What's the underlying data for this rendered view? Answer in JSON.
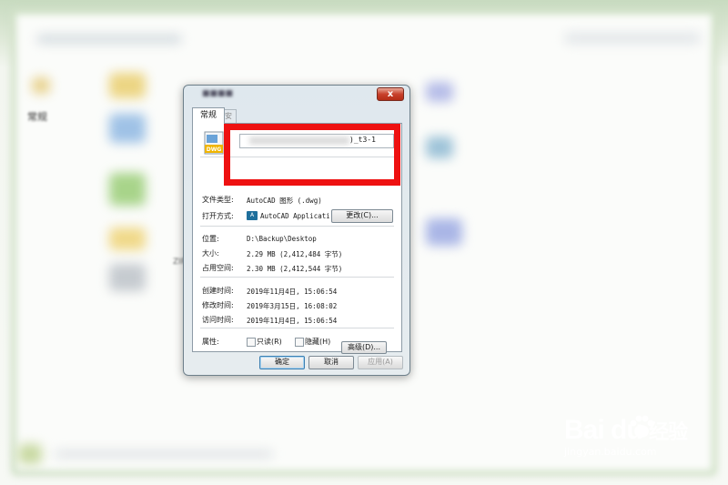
{
  "dialog": {
    "tab_general": "常规",
    "tab_second": "安",
    "file_name_suffix": ")_t3-1",
    "file_icon_label": "DWG",
    "close_symbol": "x",
    "rows": {
      "file_type_label": "文件类型:",
      "file_type_value": "AutoCAD 图形 (.dwg)",
      "open_with_label": "打开方式:",
      "open_with_value": "AutoCAD Applicatio",
      "change_button": "更改(C)...",
      "location_label": "位置:",
      "location_value": "D:\\Backup\\Desktop",
      "size_label": "大小:",
      "size_value": "2.29 MB (2,412,484 字节)",
      "disk_size_label": "占用空间:",
      "disk_size_value": "2.30 MB (2,412,544 字节)",
      "created_label": "创建时间:",
      "created_value": "2019年11月4日, 15:06:54",
      "modified_label": "修改时间:",
      "modified_value": "2019年3月15日, 16:08:02",
      "accessed_label": "访问时间:",
      "accessed_value": "2019年11月4日, 15:06:54",
      "attributes_label": "属性:",
      "readonly_label": "只读(R)",
      "hidden_label": "隐藏(H)",
      "advanced_button": "高级(D)..."
    },
    "buttons": {
      "ok": "确定",
      "cancel": "取消",
      "apply": "应用(A)"
    }
  },
  "background": {
    "sidebar_item": "常规",
    "zip_label": "ZIP"
  },
  "watermark": {
    "logo_text": "Bai  du",
    "logo_suffix": "经验",
    "url": "jingyan.baidu.com"
  },
  "colors": {
    "highlight": "#ee1111",
    "close_button": "#c8402b",
    "frame": "#a8c39a"
  }
}
